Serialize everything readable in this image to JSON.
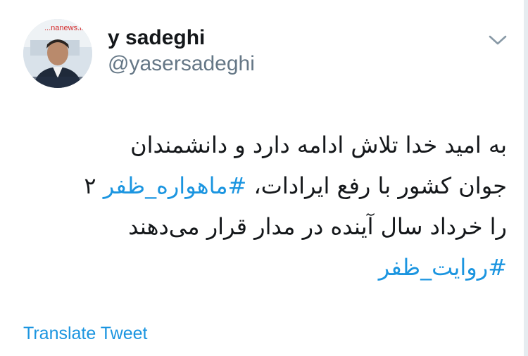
{
  "author": {
    "display_name": "y sadeghi",
    "handle": "@yasersadeghi",
    "avatar_watermark": "...nanews.ir"
  },
  "icons": {
    "menu": "chevron-down-icon",
    "avatar": "profile-photo"
  },
  "tweet": {
    "line1": "به امید خدا تلاش ادامه دارد و دانشمندان",
    "line2_text": "جوان کشور با رفع ایرادات، ",
    "line2_hashtag": "#ماهواره_ظفر",
    "line2_suffix": " ۲",
    "line3": "را خرداد سال آینده در مدار قرار می‌دهند",
    "line4_hashtag": "#روایت_ظفر"
  },
  "actions": {
    "translate": "Translate Tweet"
  },
  "colors": {
    "link": "#1b95e0",
    "text": "#14171a",
    "secondary": "#657786"
  }
}
